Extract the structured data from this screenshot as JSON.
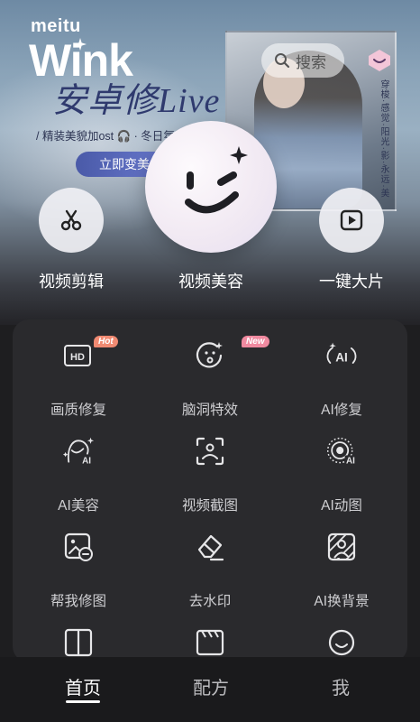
{
  "banner": {
    "brand_small": "meitu",
    "brand_logo": "Wink",
    "headline": "安卓修Live",
    "subline": "/ 精装美貌加ost 🎧 · 冬日氛",
    "cta_label": "立即变美",
    "vertical_caption": "穿梭·感觉·阳光·影·永远·美"
  },
  "search": {
    "placeholder": "搜索",
    "icon": "search-icon"
  },
  "vip": {
    "icon": "vip-diamond-icon",
    "color": "#f3c6d8"
  },
  "quick_actions": [
    {
      "label": "视频剪辑",
      "icon": "scissors-icon"
    },
    {
      "label": "视频美容",
      "icon": "wink-face-icon"
    },
    {
      "label": "一键大片",
      "icon": "play-icon"
    }
  ],
  "tools": [
    {
      "label": "画质修复",
      "icon": "hd-icon",
      "badge": "Hot"
    },
    {
      "label": "脑洞特效",
      "icon": "face-sparkle-icon",
      "badge": "New"
    },
    {
      "label": "AI修复",
      "icon": "ai-sparkle-icon",
      "badge": ""
    },
    {
      "label": "AI美容",
      "icon": "ai-face-icon",
      "badge": ""
    },
    {
      "label": "视频截图",
      "icon": "screenshot-icon",
      "badge": ""
    },
    {
      "label": "AI动图",
      "icon": "ai-live-icon",
      "badge": ""
    },
    {
      "label": "帮我修图",
      "icon": "photo-edit-icon",
      "badge": ""
    },
    {
      "label": "去水印",
      "icon": "eraser-icon",
      "badge": ""
    },
    {
      "label": "AI换背景",
      "icon": "background-swap-icon",
      "badge": ""
    }
  ],
  "nav": {
    "home": "首页",
    "recipes": "配方",
    "me": "我"
  },
  "colors": {
    "panel": "#2a2a2d",
    "hot_badge": "#f08a72",
    "new_badge": "#f08aa0",
    "cta": "#5564b8"
  }
}
